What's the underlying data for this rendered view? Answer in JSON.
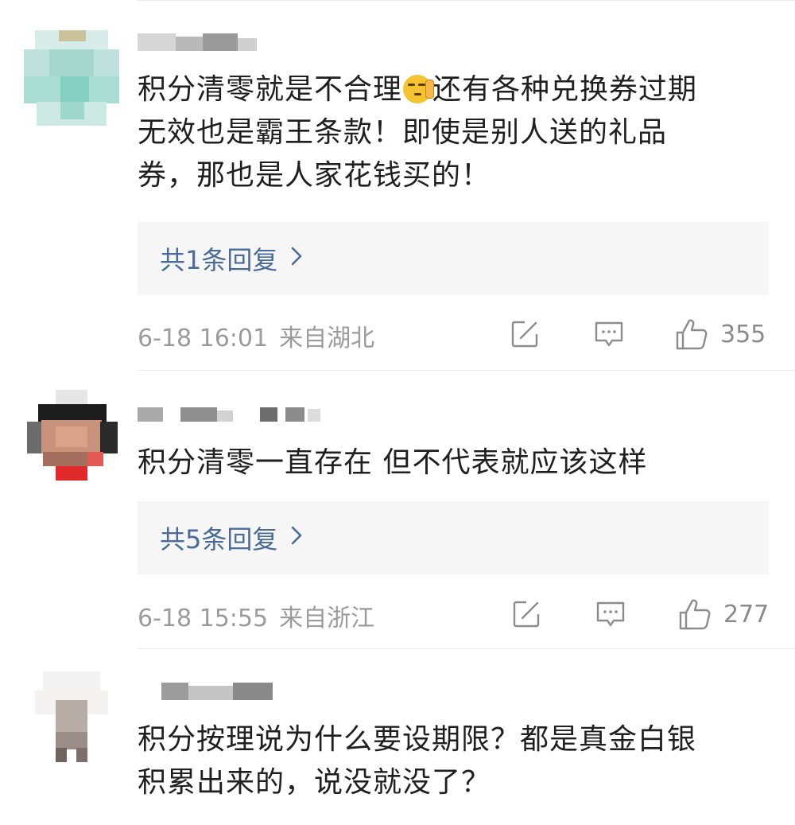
{
  "comments": [
    {
      "text_line1a": "积分清零就是不合理",
      "text_line1b": "还有各种兑换券过期",
      "text_line2": "无效也是霸王条款！即使是别人送的礼品",
      "text_line3": "券，那也是人家花钱买的！",
      "emoji": "face-hand-over-mouth-emoji",
      "reply_label": "共1条回复",
      "date": "6-18 16:01",
      "location": "来自湖北",
      "likes": "355"
    },
    {
      "text_line1": "积分清零一直存在  但不代表就应该这样",
      "reply_label": "共5条回复",
      "date": "6-18 15:55",
      "location": "来自浙江",
      "likes": "277"
    },
    {
      "text_line1": "积分按理说为什么要设期限？都是真金白银",
      "text_line2": "积累出来的，说没就没了？"
    }
  ],
  "icons": {
    "reply_chevron": "chevron-right-icon",
    "share": "share-icon",
    "comment": "comment-icon",
    "like": "like-icon"
  },
  "colors": {
    "link_blue": "#4a6b99",
    "meta_gray": "#9b9b9b",
    "reply_bg": "#f6f6f6"
  }
}
